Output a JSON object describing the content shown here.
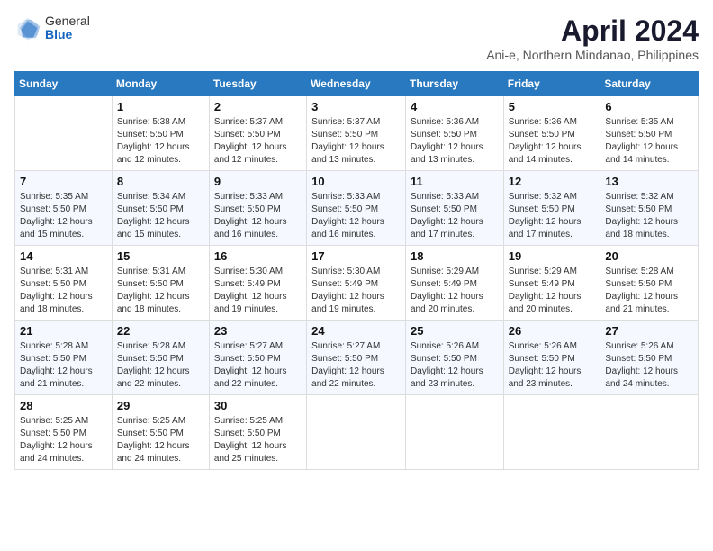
{
  "logo": {
    "general": "General",
    "blue": "Blue"
  },
  "title": "April 2024",
  "subtitle": "Ani-e, Northern Mindanao, Philippines",
  "days_header": [
    "Sunday",
    "Monday",
    "Tuesday",
    "Wednesday",
    "Thursday",
    "Friday",
    "Saturday"
  ],
  "weeks": [
    [
      {
        "num": "",
        "info": ""
      },
      {
        "num": "1",
        "info": "Sunrise: 5:38 AM\nSunset: 5:50 PM\nDaylight: 12 hours\nand 12 minutes."
      },
      {
        "num": "2",
        "info": "Sunrise: 5:37 AM\nSunset: 5:50 PM\nDaylight: 12 hours\nand 12 minutes."
      },
      {
        "num": "3",
        "info": "Sunrise: 5:37 AM\nSunset: 5:50 PM\nDaylight: 12 hours\nand 13 minutes."
      },
      {
        "num": "4",
        "info": "Sunrise: 5:36 AM\nSunset: 5:50 PM\nDaylight: 12 hours\nand 13 minutes."
      },
      {
        "num": "5",
        "info": "Sunrise: 5:36 AM\nSunset: 5:50 PM\nDaylight: 12 hours\nand 14 minutes."
      },
      {
        "num": "6",
        "info": "Sunrise: 5:35 AM\nSunset: 5:50 PM\nDaylight: 12 hours\nand 14 minutes."
      }
    ],
    [
      {
        "num": "7",
        "info": "Sunrise: 5:35 AM\nSunset: 5:50 PM\nDaylight: 12 hours\nand 15 minutes."
      },
      {
        "num": "8",
        "info": "Sunrise: 5:34 AM\nSunset: 5:50 PM\nDaylight: 12 hours\nand 15 minutes."
      },
      {
        "num": "9",
        "info": "Sunrise: 5:33 AM\nSunset: 5:50 PM\nDaylight: 12 hours\nand 16 minutes."
      },
      {
        "num": "10",
        "info": "Sunrise: 5:33 AM\nSunset: 5:50 PM\nDaylight: 12 hours\nand 16 minutes."
      },
      {
        "num": "11",
        "info": "Sunrise: 5:33 AM\nSunset: 5:50 PM\nDaylight: 12 hours\nand 17 minutes."
      },
      {
        "num": "12",
        "info": "Sunrise: 5:32 AM\nSunset: 5:50 PM\nDaylight: 12 hours\nand 17 minutes."
      },
      {
        "num": "13",
        "info": "Sunrise: 5:32 AM\nSunset: 5:50 PM\nDaylight: 12 hours\nand 18 minutes."
      }
    ],
    [
      {
        "num": "14",
        "info": "Sunrise: 5:31 AM\nSunset: 5:50 PM\nDaylight: 12 hours\nand 18 minutes."
      },
      {
        "num": "15",
        "info": "Sunrise: 5:31 AM\nSunset: 5:50 PM\nDaylight: 12 hours\nand 18 minutes."
      },
      {
        "num": "16",
        "info": "Sunrise: 5:30 AM\nSunset: 5:49 PM\nDaylight: 12 hours\nand 19 minutes."
      },
      {
        "num": "17",
        "info": "Sunrise: 5:30 AM\nSunset: 5:49 PM\nDaylight: 12 hours\nand 19 minutes."
      },
      {
        "num": "18",
        "info": "Sunrise: 5:29 AM\nSunset: 5:49 PM\nDaylight: 12 hours\nand 20 minutes."
      },
      {
        "num": "19",
        "info": "Sunrise: 5:29 AM\nSunset: 5:49 PM\nDaylight: 12 hours\nand 20 minutes."
      },
      {
        "num": "20",
        "info": "Sunrise: 5:28 AM\nSunset: 5:50 PM\nDaylight: 12 hours\nand 21 minutes."
      }
    ],
    [
      {
        "num": "21",
        "info": "Sunrise: 5:28 AM\nSunset: 5:50 PM\nDaylight: 12 hours\nand 21 minutes."
      },
      {
        "num": "22",
        "info": "Sunrise: 5:28 AM\nSunset: 5:50 PM\nDaylight: 12 hours\nand 22 minutes."
      },
      {
        "num": "23",
        "info": "Sunrise: 5:27 AM\nSunset: 5:50 PM\nDaylight: 12 hours\nand 22 minutes."
      },
      {
        "num": "24",
        "info": "Sunrise: 5:27 AM\nSunset: 5:50 PM\nDaylight: 12 hours\nand 22 minutes."
      },
      {
        "num": "25",
        "info": "Sunrise: 5:26 AM\nSunset: 5:50 PM\nDaylight: 12 hours\nand 23 minutes."
      },
      {
        "num": "26",
        "info": "Sunrise: 5:26 AM\nSunset: 5:50 PM\nDaylight: 12 hours\nand 23 minutes."
      },
      {
        "num": "27",
        "info": "Sunrise: 5:26 AM\nSunset: 5:50 PM\nDaylight: 12 hours\nand 24 minutes."
      }
    ],
    [
      {
        "num": "28",
        "info": "Sunrise: 5:25 AM\nSunset: 5:50 PM\nDaylight: 12 hours\nand 24 minutes."
      },
      {
        "num": "29",
        "info": "Sunrise: 5:25 AM\nSunset: 5:50 PM\nDaylight: 12 hours\nand 24 minutes."
      },
      {
        "num": "30",
        "info": "Sunrise: 5:25 AM\nSunset: 5:50 PM\nDaylight: 12 hours\nand 25 minutes."
      },
      {
        "num": "",
        "info": ""
      },
      {
        "num": "",
        "info": ""
      },
      {
        "num": "",
        "info": ""
      },
      {
        "num": "",
        "info": ""
      }
    ]
  ]
}
